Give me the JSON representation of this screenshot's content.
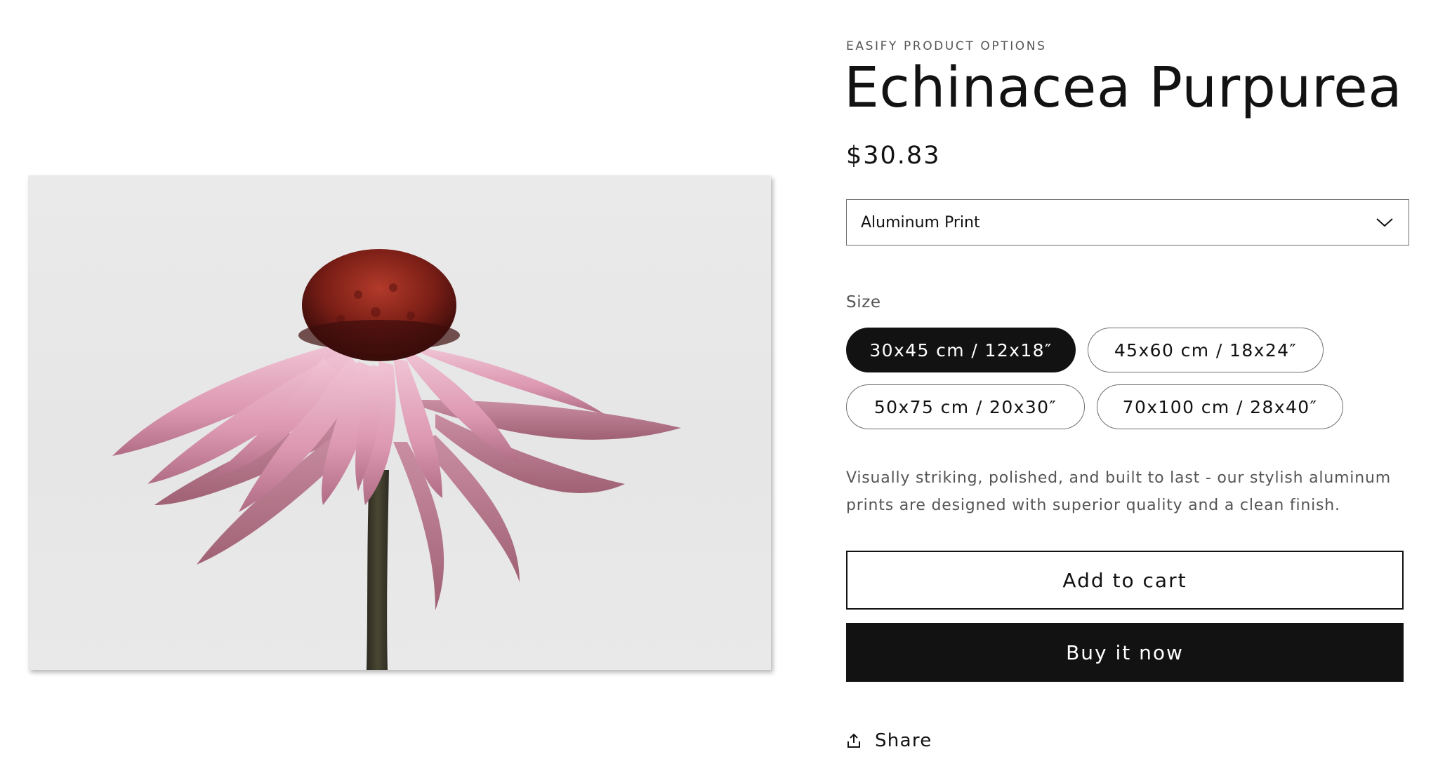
{
  "product": {
    "vendor": "EASIFY PRODUCT OPTIONS",
    "title": "Echinacea Purpurea",
    "price": "$30.83",
    "image_subject": "pink echinacea flower photograph"
  },
  "material_select": {
    "selected": "Aluminum Print"
  },
  "size_options": {
    "label": "Size",
    "options": [
      {
        "label": "30x45 cm / 12x18″",
        "selected": true
      },
      {
        "label": "45x60 cm / 18x24″",
        "selected": false
      },
      {
        "label": "50x75 cm / 20x30″",
        "selected": false
      },
      {
        "label": "70x100 cm / 28x40″",
        "selected": false
      }
    ]
  },
  "description": "Visually striking, polished, and built to last - our stylish aluminum prints are designed with superior quality and a clean finish.",
  "buttons": {
    "add_to_cart": "Add to cart",
    "buy_now": "Buy it now"
  },
  "share": {
    "label": "Share",
    "icon": "share-icon"
  },
  "colors": {
    "text": "#121212",
    "muted_text": "#555555",
    "border": "#6e6e6e",
    "primary_button": "#121212",
    "background": "#ffffff"
  }
}
